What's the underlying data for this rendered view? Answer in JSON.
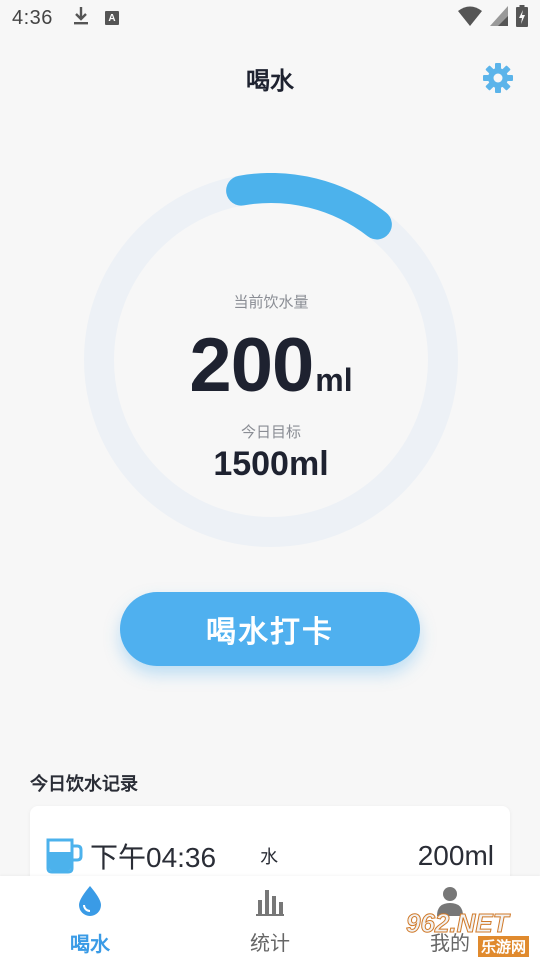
{
  "status_bar": {
    "time": "4:36",
    "left_icons": [
      "download-icon",
      "app-a-icon"
    ],
    "app_icon_letter": "A",
    "right_icons": [
      "wifi-icon",
      "cell-signal-icon",
      "battery-charging-icon"
    ]
  },
  "header": {
    "title": "喝水",
    "settings_icon": "gear-icon"
  },
  "gauge": {
    "current_label": "当前饮水量",
    "current_value": "200",
    "current_unit": "ml",
    "goal_label": "今日目标",
    "goal_value": "1500ml",
    "progress_fraction": 0.1333,
    "track_color": "#edf1f6",
    "progress_color": "#4cb2ec"
  },
  "checkin_button": {
    "label": "喝水打卡",
    "color": "#4fb0ef"
  },
  "records": {
    "title": "今日饮水记录",
    "items": [
      {
        "icon": "cup-icon",
        "time": "下午04:36",
        "type": "水",
        "amount": "200ml"
      }
    ]
  },
  "bottom_nav": {
    "items": [
      {
        "label": "喝水",
        "icon": "water-drop-icon",
        "active": true
      },
      {
        "label": "统计",
        "icon": "bar-chart-icon",
        "active": false
      },
      {
        "label": "我的",
        "icon": "user-icon",
        "active": false
      }
    ],
    "active_color": "#3a9be6"
  },
  "watermark": {
    "main": "962.NET",
    "sub": "乐游网"
  }
}
